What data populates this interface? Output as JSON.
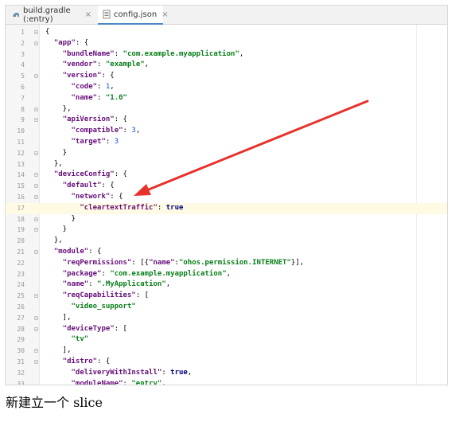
{
  "tabs": [
    {
      "label": "build.gradle (:entry)",
      "close": "×",
      "active": false
    },
    {
      "label": "config.json",
      "close": "×",
      "active": true
    }
  ],
  "editor": {
    "current_line": 17,
    "lines": [
      {
        "n": "1",
        "t": [
          [
            "{",
            "p"
          ]
        ]
      },
      {
        "n": "2",
        "t": [
          [
            "  ",
            "p"
          ],
          [
            "\"app\"",
            "k"
          ],
          [
            ": {",
            "p"
          ]
        ]
      },
      {
        "n": "3",
        "t": [
          [
            "    ",
            "p"
          ],
          [
            "\"bundleName\"",
            "k"
          ],
          [
            ": ",
            "p"
          ],
          [
            "\"com.example.myapplication\"",
            "s"
          ],
          [
            ",",
            "p"
          ]
        ]
      },
      {
        "n": "4",
        "t": [
          [
            "    ",
            "p"
          ],
          [
            "\"vendor\"",
            "k"
          ],
          [
            ": ",
            "p"
          ],
          [
            "\"example\"",
            "s"
          ],
          [
            ",",
            "p"
          ]
        ]
      },
      {
        "n": "5",
        "t": [
          [
            "    ",
            "p"
          ],
          [
            "\"version\"",
            "k"
          ],
          [
            ": {",
            "p"
          ]
        ]
      },
      {
        "n": "6",
        "t": [
          [
            "      ",
            "p"
          ],
          [
            "\"code\"",
            "k"
          ],
          [
            ": ",
            "p"
          ],
          [
            "1",
            "n"
          ],
          [
            ",",
            "p"
          ]
        ]
      },
      {
        "n": "7",
        "t": [
          [
            "      ",
            "p"
          ],
          [
            "\"name\"",
            "k"
          ],
          [
            ": ",
            "p"
          ],
          [
            "\"1.0\"",
            "s"
          ]
        ]
      },
      {
        "n": "8",
        "t": [
          [
            "    },",
            "p"
          ]
        ]
      },
      {
        "n": "9",
        "t": [
          [
            "    ",
            "p"
          ],
          [
            "\"apiVersion\"",
            "k"
          ],
          [
            ": {",
            "p"
          ]
        ]
      },
      {
        "n": "10",
        "t": [
          [
            "      ",
            "p"
          ],
          [
            "\"compatible\"",
            "k"
          ],
          [
            ": ",
            "p"
          ],
          [
            "3",
            "n"
          ],
          [
            ",",
            "p"
          ]
        ]
      },
      {
        "n": "11",
        "t": [
          [
            "      ",
            "p"
          ],
          [
            "\"target\"",
            "k"
          ],
          [
            ": ",
            "p"
          ],
          [
            "3",
            "n"
          ]
        ]
      },
      {
        "n": "12",
        "t": [
          [
            "    }",
            "p"
          ]
        ]
      },
      {
        "n": "13",
        "t": [
          [
            "  },",
            "p"
          ]
        ]
      },
      {
        "n": "14",
        "t": [
          [
            "  ",
            "p"
          ],
          [
            "\"deviceConfig\"",
            "k"
          ],
          [
            ": {",
            "p"
          ]
        ]
      },
      {
        "n": "15",
        "t": [
          [
            "    ",
            "p"
          ],
          [
            "\"default\"",
            "k"
          ],
          [
            ": {",
            "p"
          ]
        ]
      },
      {
        "n": "16",
        "t": [
          [
            "      ",
            "p"
          ],
          [
            "\"network\"",
            "k"
          ],
          [
            ": {",
            "p"
          ]
        ]
      },
      {
        "n": "17",
        "t": [
          [
            "        ",
            "p"
          ],
          [
            "\"cleartextTraffic\"",
            "k"
          ],
          [
            ": ",
            "p"
          ],
          [
            "true",
            "kw"
          ]
        ]
      },
      {
        "n": "18",
        "t": [
          [
            "      }",
            "p"
          ]
        ]
      },
      {
        "n": "19",
        "t": [
          [
            "    }",
            "p"
          ]
        ]
      },
      {
        "n": "20",
        "t": [
          [
            "  },",
            "p"
          ]
        ]
      },
      {
        "n": "21",
        "t": [
          [
            "  ",
            "p"
          ],
          [
            "\"module\"",
            "k"
          ],
          [
            ": {",
            "p"
          ]
        ]
      },
      {
        "n": "22",
        "t": [
          [
            "    ",
            "p"
          ],
          [
            "\"reqPermissions\"",
            "k"
          ],
          [
            ": [{",
            "p"
          ],
          [
            "\"name\"",
            "k"
          ],
          [
            ":",
            "p"
          ],
          [
            "\"ohos.permission.INTERNET\"",
            "s"
          ],
          [
            "}],",
            "p"
          ]
        ]
      },
      {
        "n": "23",
        "t": [
          [
            "    ",
            "p"
          ],
          [
            "\"package\"",
            "k"
          ],
          [
            ": ",
            "p"
          ],
          [
            "\"com.example.myapplication\"",
            "s"
          ],
          [
            ",",
            "p"
          ]
        ]
      },
      {
        "n": "24",
        "t": [
          [
            "    ",
            "p"
          ],
          [
            "\"name\"",
            "k"
          ],
          [
            ": ",
            "p"
          ],
          [
            "\".MyApplication\"",
            "s"
          ],
          [
            ",",
            "p"
          ]
        ]
      },
      {
        "n": "25",
        "t": [
          [
            "    ",
            "p"
          ],
          [
            "\"reqCapabilities\"",
            "k"
          ],
          [
            ": [",
            "p"
          ]
        ]
      },
      {
        "n": "26",
        "t": [
          [
            "      ",
            "p"
          ],
          [
            "\"video_support\"",
            "s"
          ]
        ]
      },
      {
        "n": "27",
        "t": [
          [
            "    ],",
            "p"
          ]
        ]
      },
      {
        "n": "28",
        "t": [
          [
            "    ",
            "p"
          ],
          [
            "\"deviceType\"",
            "k"
          ],
          [
            ": [",
            "p"
          ]
        ]
      },
      {
        "n": "29",
        "t": [
          [
            "      ",
            "p"
          ],
          [
            "\"tv\"",
            "s"
          ]
        ]
      },
      {
        "n": "30",
        "t": [
          [
            "    ],",
            "p"
          ]
        ]
      },
      {
        "n": "31",
        "t": [
          [
            "    ",
            "p"
          ],
          [
            "\"distro\"",
            "k"
          ],
          [
            ": {",
            "p"
          ]
        ]
      },
      {
        "n": "32",
        "t": [
          [
            "      ",
            "p"
          ],
          [
            "\"deliveryWithInstall\"",
            "k"
          ],
          [
            ": ",
            "p"
          ],
          [
            "true",
            "kw"
          ],
          [
            ",",
            "p"
          ]
        ]
      },
      {
        "n": "33",
        "t": [
          [
            "      ",
            "p"
          ],
          [
            "\"moduleName\"",
            "k"
          ],
          [
            ": ",
            "p"
          ],
          [
            "\"entry\"",
            "s"
          ],
          [
            ",",
            "p"
          ]
        ]
      }
    ],
    "folds": [
      "1",
      "2",
      "5",
      "8",
      "9",
      "12",
      "14",
      "15",
      "16",
      "18",
      "19",
      "21",
      "25",
      "27",
      "28",
      "30",
      "31"
    ]
  },
  "caption": "新建立一个 slice",
  "colors": {
    "arrow": "#e8312c",
    "accent": "#4a88c7"
  }
}
